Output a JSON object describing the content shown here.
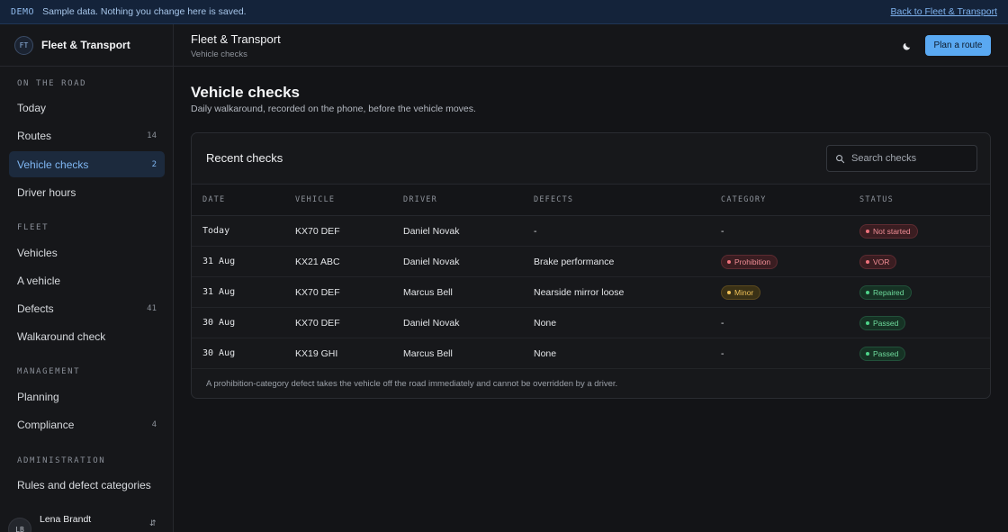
{
  "banner": {
    "tag": "DEMO",
    "message": "Sample data. Nothing you change here is saved.",
    "back_link": "Back to Fleet & Transport"
  },
  "brand": {
    "initials": "FT",
    "name": "Fleet & Transport"
  },
  "sidebar": {
    "sections": [
      {
        "label": "ON THE ROAD",
        "items": [
          {
            "label": "Today",
            "count": ""
          },
          {
            "label": "Routes",
            "count": "14"
          },
          {
            "label": "Vehicle checks",
            "count": "2",
            "active": true
          },
          {
            "label": "Driver hours",
            "count": ""
          }
        ]
      },
      {
        "label": "FLEET",
        "items": [
          {
            "label": "Vehicles",
            "count": ""
          },
          {
            "label": "A vehicle",
            "count": ""
          },
          {
            "label": "Defects",
            "count": "41"
          },
          {
            "label": "Walkaround check",
            "count": ""
          }
        ]
      },
      {
        "label": "MANAGEMENT",
        "items": [
          {
            "label": "Planning",
            "count": ""
          },
          {
            "label": "Compliance",
            "count": "4"
          }
        ]
      },
      {
        "label": "ADMINISTRATION",
        "items": [
          {
            "label": "Rules and defect categories",
            "count": ""
          }
        ]
      }
    ],
    "user": {
      "initials": "LB",
      "name": "Lena Brandt"
    }
  },
  "header": {
    "title": "Fleet & Transport",
    "breadcrumb": "Vehicle checks",
    "theme_icon": "moon-icon",
    "cta_label": "Plan a route"
  },
  "main": {
    "title": "Vehicle checks",
    "subtitle": "Daily walkaround, recorded on the phone, before the vehicle moves.",
    "card_title": "Recent checks",
    "search_placeholder": "Search checks",
    "columns": [
      "DATE",
      "VEHICLE",
      "DRIVER",
      "DEFECTS",
      "CATEGORY",
      "STATUS"
    ],
    "rows": [
      {
        "date": "Today",
        "vehicle": "KX70 DEF",
        "driver": "Daniel Novak",
        "defects": "-",
        "category": "-",
        "category_tone": "",
        "status": "Not started",
        "status_tone": "red"
      },
      {
        "date": "31 Aug",
        "vehicle": "KX21 ABC",
        "driver": "Daniel Novak",
        "defects": "Brake performance",
        "category": "Prohibition",
        "category_tone": "red",
        "status": "VOR",
        "status_tone": "red"
      },
      {
        "date": "31 Aug",
        "vehicle": "KX70 DEF",
        "driver": "Marcus Bell",
        "defects": "Nearside mirror loose",
        "category": "Minor",
        "category_tone": "amber",
        "status": "Repaired",
        "status_tone": "green"
      },
      {
        "date": "30 Aug",
        "vehicle": "KX70 DEF",
        "driver": "Daniel Novak",
        "defects": "None",
        "category": "-",
        "category_tone": "",
        "status": "Passed",
        "status_tone": "green"
      },
      {
        "date": "30 Aug",
        "vehicle": "KX19 GHI",
        "driver": "Marcus Bell",
        "defects": "None",
        "category": "-",
        "category_tone": "",
        "status": "Passed",
        "status_tone": "green"
      }
    ],
    "footnote": "A prohibition-category defect takes the vehicle off the road immediately and cannot be overridden by a driver."
  },
  "colors": {
    "accent": "#5aa9f2",
    "danger": "#f0727c",
    "warning": "#f1c258",
    "success": "#4fd48a"
  }
}
